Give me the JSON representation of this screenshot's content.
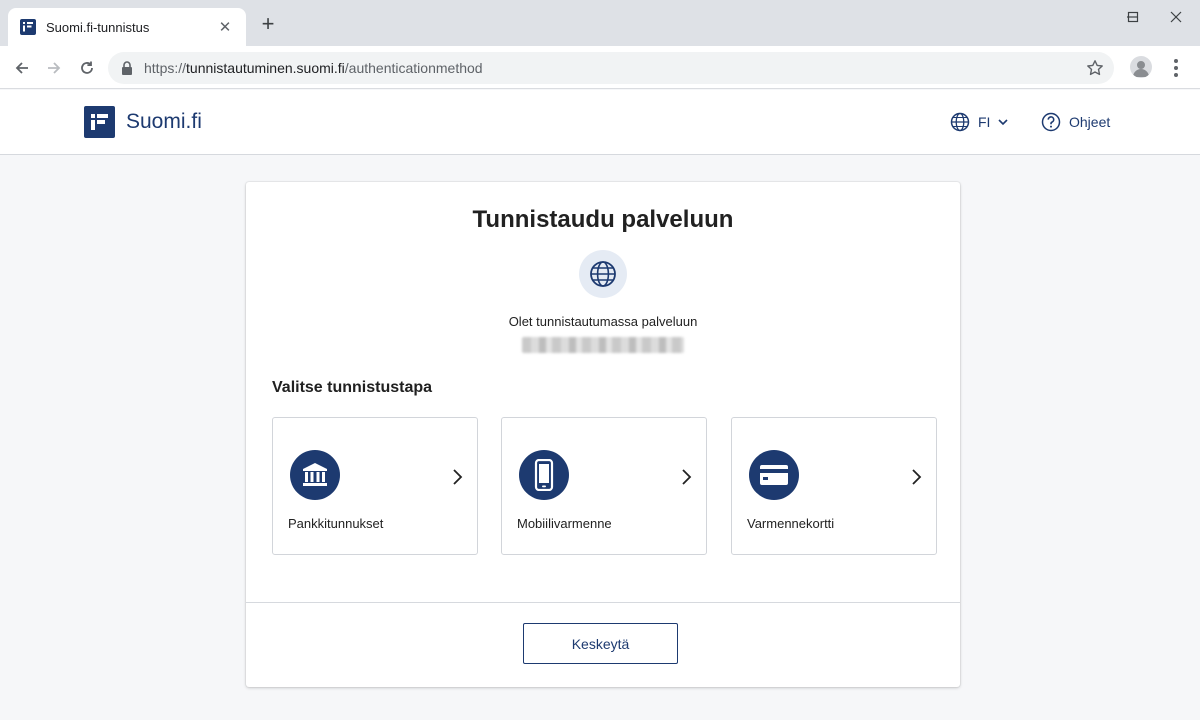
{
  "browser": {
    "tab_title": "Suomi.fi-tunnistus",
    "tab_close": "✕",
    "new_tab": "+",
    "url_scheme": "https://",
    "url_host": "tunnistautuminen.suomi.fi",
    "url_path": "/authenticationmethod"
  },
  "header": {
    "brand": "Suomi.fi",
    "language": "FI",
    "help": "Ohjeet"
  },
  "card": {
    "title": "Tunnistaudu palveluun",
    "service_label": "Olet tunnistautumassa palveluun",
    "methods_heading": "Valitse tunnistustapa",
    "methods": [
      {
        "label": "Pankkitunnukset",
        "icon": "bank-icon"
      },
      {
        "label": "Mobiilivarmenne",
        "icon": "mobile-phone-icon"
      },
      {
        "label": "Varmennekortti",
        "icon": "id-card-icon"
      }
    ],
    "cancel_label": "Keskeytä"
  },
  "colors": {
    "brand_blue": "#1d3a70",
    "globe_bg": "#e5ebf4",
    "page_bg": "#f6f7f9"
  }
}
